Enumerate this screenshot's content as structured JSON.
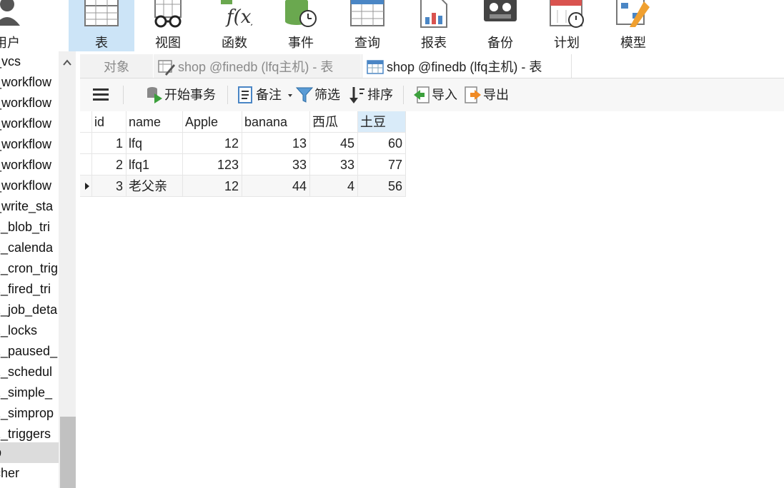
{
  "ribbon": {
    "items": [
      {
        "label": "用户",
        "icon": "user-icon"
      },
      {
        "label": "表",
        "icon": "table-icon"
      },
      {
        "label": "视图",
        "icon": "view-glasses-icon"
      },
      {
        "label": "函数",
        "icon": "function-icon"
      },
      {
        "label": "事件",
        "icon": "event-clock-icon"
      },
      {
        "label": "查询",
        "icon": "query-icon"
      },
      {
        "label": "报表",
        "icon": "report-icon"
      },
      {
        "label": "备份",
        "icon": "backup-icon"
      },
      {
        "label": "计划",
        "icon": "calendar-icon"
      },
      {
        "label": "模型",
        "icon": "model-icon"
      }
    ],
    "active": "表"
  },
  "sidebar": {
    "items": [
      "_vcs",
      "_workflow",
      "_workflow",
      "_workflow",
      "_workflow",
      "_workflow",
      "_workflow",
      "_write_sta",
      "z_blob_tri",
      "z_calenda",
      "z_cron_trig",
      "z_fired_tri",
      "z_job_deta",
      "z_locks",
      "z_paused_",
      "z_schedul",
      "z_simple_",
      "z_simprop",
      "z_triggers",
      "p",
      "cher"
    ],
    "selected_index": 19
  },
  "tabs": [
    {
      "label": "对象",
      "icon": ""
    },
    {
      "label": "shop @finedb (lfq主机) - 表",
      "icon": "edit-table-icon"
    },
    {
      "label": "shop @finedb (lfq主机) - 表",
      "icon": "table-icon"
    }
  ],
  "toolbar": {
    "begin_transaction": "开始事务",
    "note": "备注",
    "filter": "筛选",
    "sort": "排序",
    "import": "导入",
    "export": "导出"
  },
  "table": {
    "columns": [
      "id",
      "name",
      "Apple",
      "banana",
      "西瓜",
      "土豆"
    ],
    "selected_column": 5,
    "rows": [
      [
        "1",
        "lfq",
        "12",
        "13",
        "45",
        "60"
      ],
      [
        "2",
        "lfq1",
        "123",
        "33",
        "33",
        "77"
      ],
      [
        "3",
        "老父亲",
        "12",
        "44",
        "4",
        "56"
      ]
    ],
    "current_row": 2
  },
  "colors": {
    "active_ribbon": "#cce4f7",
    "selected_header": "#d9ebf9",
    "green_icon": "#6aa84f",
    "blue_icon": "#4a86c5",
    "red_icon": "#d9534f"
  }
}
